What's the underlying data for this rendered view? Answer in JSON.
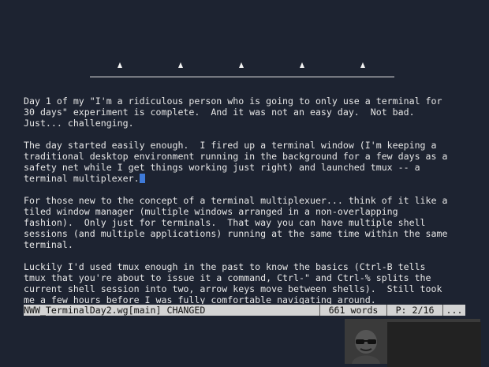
{
  "ruler": {
    "tab_marks": [
      "▲",
      "▲",
      "▲",
      "▲",
      "▲"
    ]
  },
  "document": {
    "paragraphs": [
      "Day 1 of my \"I'm a ridiculous person who is going to only use a terminal for\n30 days\" experiment is complete.  And it was not an easy day.  Not bad.\nJust... challenging.",
      "The day started easily enough.  I fired up a terminal window (I'm keeping a\ntraditional desktop environment running in the background for a few days as a\nsafety net while I get things working just right) and launched tmux -- a\nterminal multiplexer.",
      "For those new to the concept of a terminal multiplexuer... think of it like a\ntiled window manager (multiple windows arranged in a non-overlapping\nfashion).  Only just for terminals.  That way you can have multiple shell\nsessions (and multiple applications) running at the same time within the same\nterminal.",
      "Luckily I'd used tmux enough in the past to know the basics (Ctrl-B tells\ntmux that you're about to issue it a command, Ctrl-\" and Ctrl-% splits the\ncurrent shell session into two, arrow keys move between shells).  Still took\nme a few hours before I was fully comfortable navigating around."
    ]
  },
  "status": {
    "filename": "NWW_TerminalDay2.wg[main] CHANGED",
    "words": "661 words",
    "page": "P: 2/16",
    "more": "..."
  },
  "colors": {
    "background": "#1d2331",
    "cursor": "#3f7ad8",
    "status_bar": "#d3d3d3"
  },
  "icons": {
    "tab_stop": "triangle-up",
    "overlay": "sunglasses-avatar-icon"
  }
}
